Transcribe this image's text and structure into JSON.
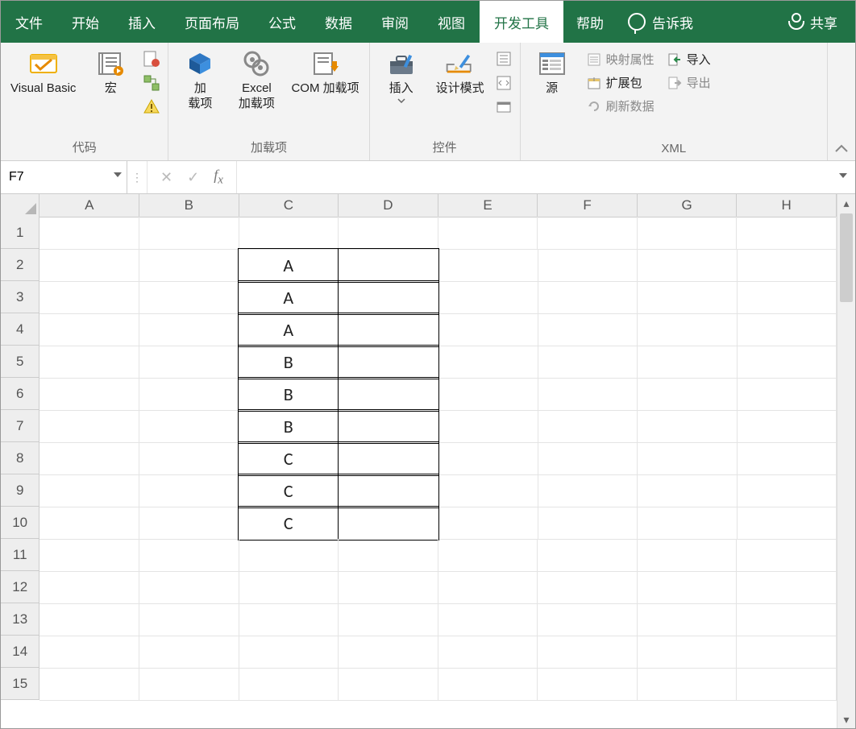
{
  "tabs": {
    "file": "文件",
    "home": "开始",
    "insert": "插入",
    "layout": "页面布局",
    "formula": "公式",
    "data": "数据",
    "review": "审阅",
    "view": "视图",
    "developer": "开发工具",
    "help": "帮助",
    "tell_me": "告诉我",
    "share": "共享"
  },
  "ribbon": {
    "code": {
      "vb": "Visual Basic",
      "macro": "宏",
      "group": "代码"
    },
    "addins": {
      "addin": "加\n载项",
      "excel_addin": "Excel\n加载项",
      "com_addin": "COM 加载项",
      "group": "加载项"
    },
    "controls": {
      "insert": "插入",
      "design": "设计模式",
      "group": "控件"
    },
    "xml": {
      "source": "源",
      "map_props": "映射属性",
      "expansion": "扩展包",
      "refresh": "刷新数据",
      "import": "导入",
      "export": "导出",
      "group": "XML"
    }
  },
  "formula_bar": {
    "name_box": "F7",
    "formula": ""
  },
  "grid": {
    "columns": [
      "A",
      "B",
      "C",
      "D",
      "E",
      "F",
      "G",
      "H"
    ],
    "row_numbers": [
      1,
      2,
      3,
      4,
      5,
      6,
      7,
      8,
      9,
      10,
      11,
      12,
      13,
      14,
      15
    ],
    "bordered_cells": {
      "C2": "A",
      "C3": "A",
      "C4": "A",
      "C5": "B",
      "C6": "B",
      "C7": "B",
      "C8": "C",
      "C9": "C",
      "C10": "C",
      "D2": "",
      "D3": "",
      "D4": "",
      "D5": "",
      "D6": "",
      "D7": "",
      "D8": "",
      "D9": "",
      "D10": ""
    }
  }
}
